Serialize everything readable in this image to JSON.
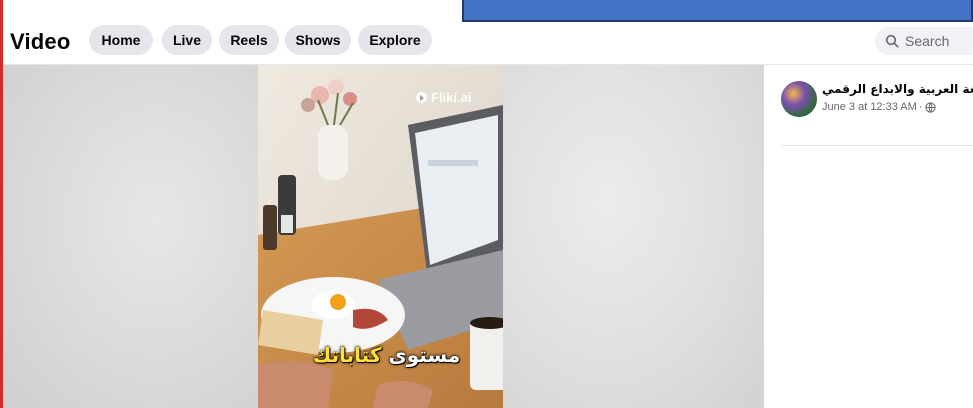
{
  "header": {
    "title": "Video",
    "tabs": [
      {
        "label": "Home"
      },
      {
        "label": "Live"
      },
      {
        "label": "Reels"
      },
      {
        "label": "Shows"
      },
      {
        "label": "Explore"
      }
    ],
    "search": {
      "placeholder": "Search",
      "icon": "search-icon"
    }
  },
  "video": {
    "watermark": "Fliki.ai",
    "caption_prefix": "مستوى",
    "caption_highlight": "كتاباتك"
  },
  "post": {
    "author": "اللغة العربية والابداع الرقمي",
    "timestamp": "June 3 at 12:33 AM",
    "privacy_icon": "globe-icon"
  },
  "colors": {
    "overlay_box": "#4472c4",
    "tab_bg": "#e4e6eb",
    "caption_highlight": "#ffe03a"
  }
}
